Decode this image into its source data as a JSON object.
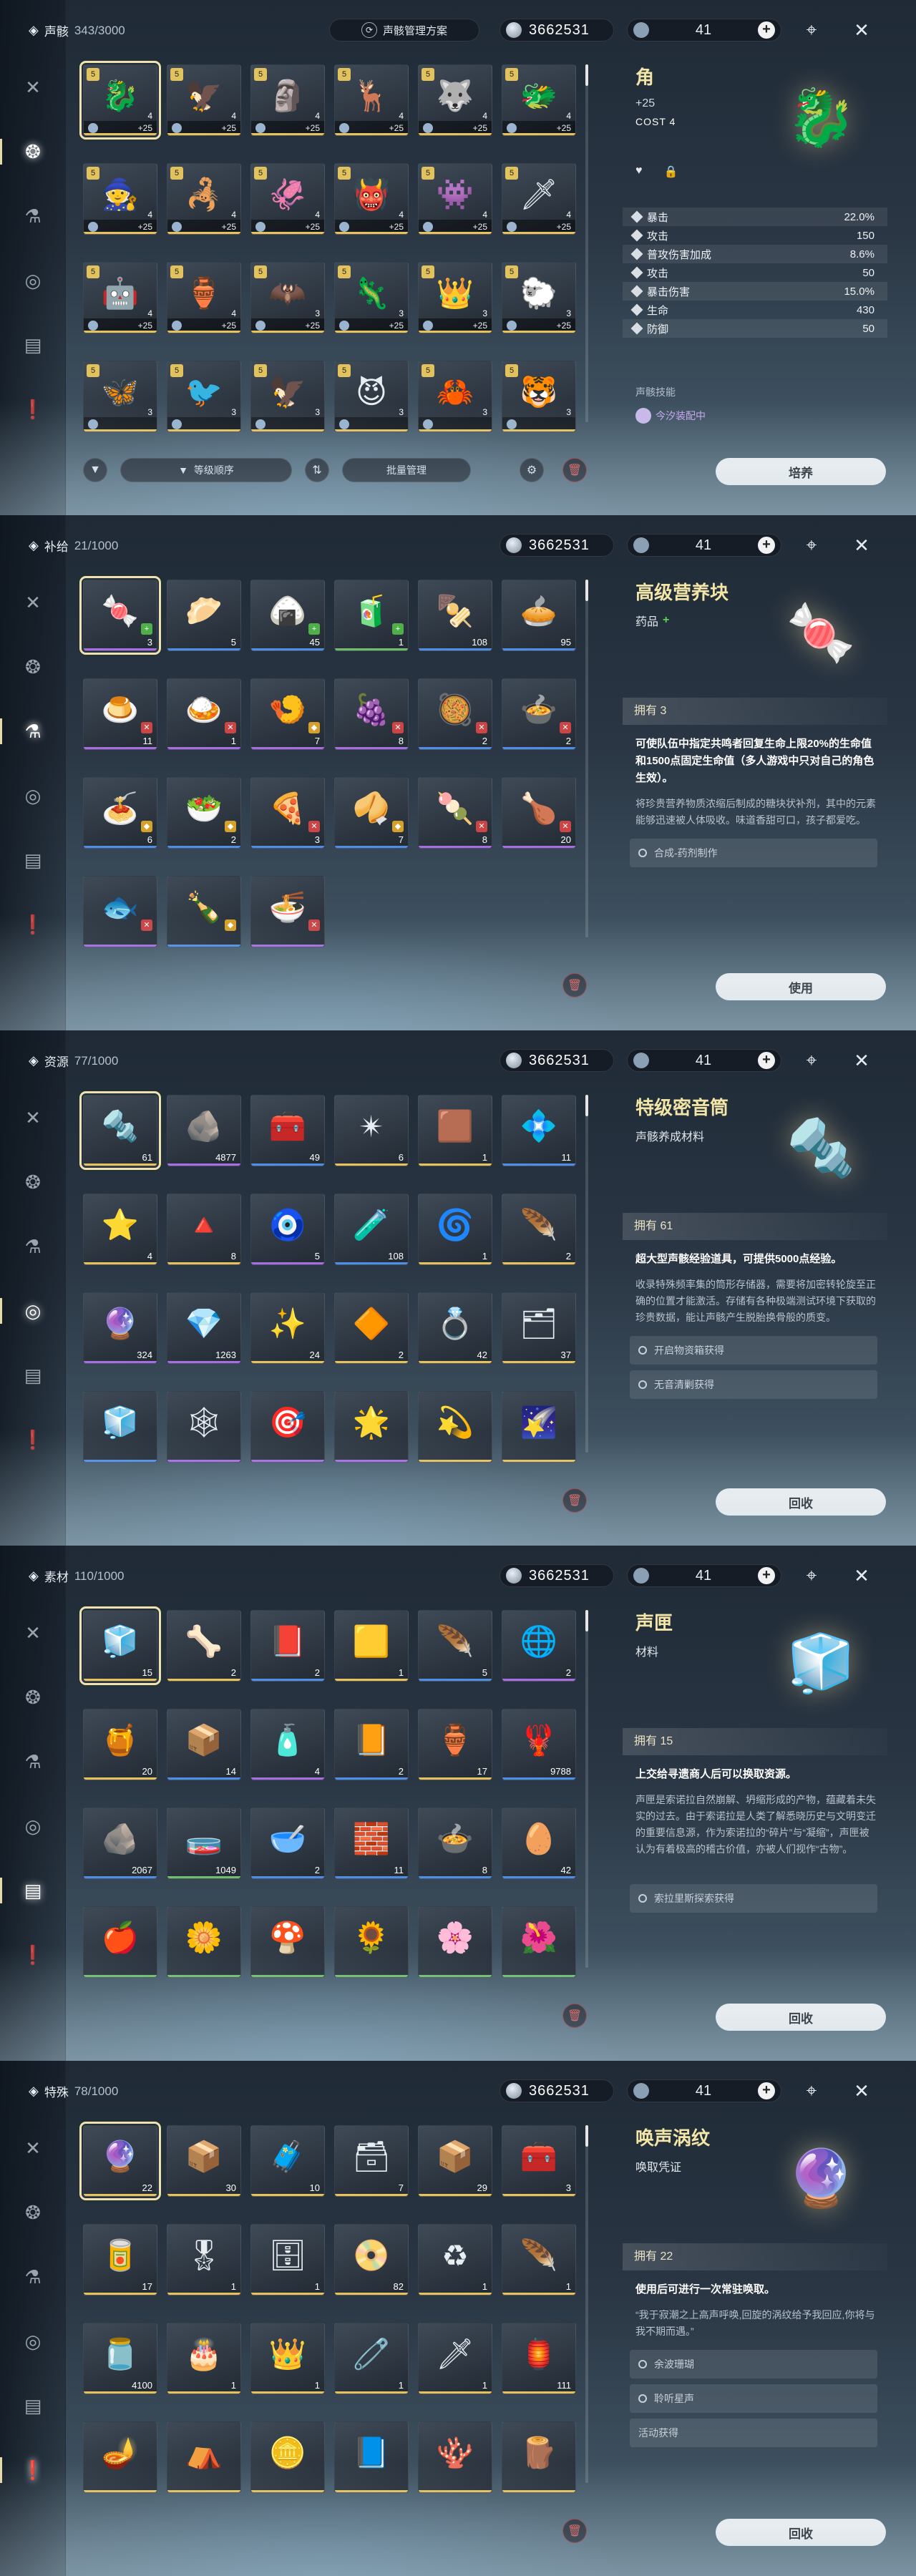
{
  "colors": {
    "accent_gold": "#f3e5a8",
    "rarity_gold": "#e7c25a",
    "rarity_purple": "#a76ce6",
    "rarity_blue": "#4f8ee8",
    "rarity_green": "#6fc06a"
  },
  "header": {
    "currency": "3662531",
    "stamina": "41",
    "plan_label": "声骸管理方案"
  },
  "nav_icons": [
    "crossed-swords-icon",
    "echo-mask-icon",
    "supplies-capsule-icon",
    "resources-icon",
    "materials-icon",
    "special-items-icon"
  ],
  "panels": [
    {
      "category": "声骸",
      "count": "343/3000",
      "active_nav": 1,
      "action": "培养",
      "sort_label": "等级顺序",
      "batch_label": "批量管理",
      "items": [
        {
          "icon": "🐉",
          "lvl": "5",
          "cost": "4",
          "plus": "+25",
          "rar": "gold",
          "sel": true
        },
        {
          "icon": "🦅",
          "lvl": "5",
          "cost": "4",
          "plus": "+25",
          "rar": "gold"
        },
        {
          "icon": "🗿",
          "lvl": "5",
          "cost": "4",
          "plus": "+25",
          "rar": "gold"
        },
        {
          "icon": "🦌",
          "lvl": "5",
          "cost": "4",
          "plus": "+25",
          "rar": "gold"
        },
        {
          "icon": "🐺",
          "lvl": "5",
          "cost": "4",
          "plus": "+25",
          "rar": "gold"
        },
        {
          "icon": "🐲",
          "lvl": "5",
          "cost": "4",
          "plus": "+25",
          "rar": "gold"
        },
        {
          "icon": "🧙",
          "lvl": "5",
          "cost": "4",
          "plus": "+25",
          "rar": "gold"
        },
        {
          "icon": "🦂",
          "lvl": "5",
          "cost": "4",
          "plus": "+25",
          "rar": "gold"
        },
        {
          "icon": "🦑",
          "lvl": "5",
          "cost": "4",
          "plus": "+25",
          "rar": "gold"
        },
        {
          "icon": "👹",
          "lvl": "5",
          "cost": "4",
          "plus": "+25",
          "rar": "gold"
        },
        {
          "icon": "👾",
          "lvl": "5",
          "cost": "4",
          "plus": "+25",
          "rar": "gold"
        },
        {
          "icon": "🗡",
          "lvl": "5",
          "cost": "4",
          "plus": "+25",
          "rar": "gold"
        },
        {
          "icon": "🤖",
          "lvl": "5",
          "cost": "4",
          "plus": "+25",
          "rar": "gold"
        },
        {
          "icon": "🏺",
          "lvl": "5",
          "cost": "4",
          "plus": "+25",
          "rar": "gold"
        },
        {
          "icon": "🦇",
          "lvl": "5",
          "cost": "3",
          "plus": "+25",
          "rar": "gold"
        },
        {
          "icon": "🦎",
          "lvl": "5",
          "cost": "3",
          "plus": "+25",
          "rar": "gold"
        },
        {
          "icon": "👑",
          "lvl": "5",
          "cost": "3",
          "plus": "+25",
          "rar": "gold"
        },
        {
          "icon": "🐑",
          "lvl": "5",
          "cost": "3",
          "plus": "+25",
          "rar": "gold"
        },
        {
          "icon": "🦋",
          "lvl": "5",
          "cost": "3",
          "plus": "",
          "rar": "gold"
        },
        {
          "icon": "🐦",
          "lvl": "5",
          "cost": "3",
          "plus": "",
          "rar": "gold"
        },
        {
          "icon": "🦅",
          "lvl": "5",
          "cost": "3",
          "plus": "",
          "rar": "gold"
        },
        {
          "icon": "😈",
          "lvl": "5",
          "cost": "3",
          "plus": "",
          "rar": "gold"
        },
        {
          "icon": "🦀",
          "lvl": "5",
          "cost": "3",
          "plus": "",
          "rar": "gold"
        },
        {
          "icon": "🐯",
          "lvl": "5",
          "cost": "3",
          "plus": "",
          "rar": "gold"
        }
      ],
      "detail": {
        "name": "角",
        "level": "+25",
        "cost": "COST 4",
        "icon": "🐉",
        "stats": [
          [
            "暴击",
            "22.0%"
          ],
          [
            "攻击",
            "150"
          ],
          [
            "普攻伤害加成",
            "8.6%"
          ],
          [
            "攻击",
            "50"
          ],
          [
            "暴击伤害",
            "15.0%"
          ],
          [
            "生命",
            "430"
          ],
          [
            "防御",
            "50"
          ]
        ],
        "skill": "声骸技能",
        "equipped": "今汐装配中"
      }
    },
    {
      "category": "补给",
      "count": "21/1000",
      "active_nav": 2,
      "action": "使用",
      "items": [
        {
          "icon": "🍬",
          "qty": "3",
          "rar": "purple",
          "mark": "g",
          "sel": true
        },
        {
          "icon": "🥟",
          "qty": "5",
          "rar": "blue"
        },
        {
          "icon": "🍙",
          "qty": "45",
          "rar": "blue",
          "mark": "g"
        },
        {
          "icon": "🧃",
          "qty": "1",
          "rar": "green",
          "mark": "g"
        },
        {
          "icon": "🍢",
          "qty": "108",
          "rar": "blue"
        },
        {
          "icon": "🥧",
          "qty": "95",
          "rar": "blue"
        },
        {
          "icon": "🍮",
          "qty": "11",
          "rar": "purple",
          "mark": "r"
        },
        {
          "icon": "🍛",
          "qty": "1",
          "rar": "purple",
          "mark": "r"
        },
        {
          "icon": "🍤",
          "qty": "7",
          "rar": "purple",
          "mark": "y"
        },
        {
          "icon": "🍇",
          "qty": "8",
          "rar": "purple",
          "mark": "r"
        },
        {
          "icon": "🥘",
          "qty": "2",
          "rar": "blue",
          "mark": "r"
        },
        {
          "icon": "🍲",
          "qty": "2",
          "rar": "blue",
          "mark": "r"
        },
        {
          "icon": "🍝",
          "qty": "6",
          "rar": "blue",
          "mark": "y"
        },
        {
          "icon": "🥗",
          "qty": "2",
          "rar": "blue",
          "mark": "y"
        },
        {
          "icon": "🍕",
          "qty": "3",
          "rar": "blue",
          "mark": "r"
        },
        {
          "icon": "🥠",
          "qty": "7",
          "rar": "blue",
          "mark": "y"
        },
        {
          "icon": "🍡",
          "qty": "8",
          "rar": "purple",
          "mark": "r"
        },
        {
          "icon": "🍗",
          "qty": "20",
          "rar": "purple",
          "mark": "r"
        },
        {
          "icon": "🐟",
          "qty": "",
          "rar": "purple",
          "mark": "r"
        },
        {
          "icon": "🍾",
          "qty": "",
          "rar": "blue",
          "mark": "y"
        },
        {
          "icon": "🍜",
          "qty": "",
          "rar": "purple",
          "mark": "r"
        }
      ],
      "detail": {
        "name": "高级营养块",
        "type": "药品",
        "icon": "🍬",
        "own": "拥有 3",
        "effect": "可使队伍中指定共鸣者回复生命上限20%的生命值和1500点固定生命值（多人游戏中只对自己的角色生效）。",
        "desc": "将珍贵营养物质浓缩后制成的糖块状补剂，其中的元素能够迅速被人体吸收。味道香甜可口，孩子都爱吃。",
        "sources": [
          "合成-药剂制作"
        ]
      }
    },
    {
      "category": "资源",
      "count": "77/1000",
      "active_nav": 3,
      "action": "回收",
      "items": [
        {
          "icon": "🔩",
          "qty": "61",
          "rar": "gold",
          "sel": true
        },
        {
          "icon": "🪨",
          "qty": "4877",
          "rar": "purple"
        },
        {
          "icon": "🧰",
          "qty": "49",
          "rar": "blue"
        },
        {
          "icon": "✴",
          "qty": "6",
          "rar": "gold"
        },
        {
          "icon": "🟫",
          "qty": "1",
          "rar": "gold"
        },
        {
          "icon": "💠",
          "qty": "11",
          "rar": "blue"
        },
        {
          "icon": "⭐",
          "qty": "4",
          "rar": "gold"
        },
        {
          "icon": "🔺",
          "qty": "8",
          "rar": "gold"
        },
        {
          "icon": "🧿",
          "qty": "5",
          "rar": "purple"
        },
        {
          "icon": "🧪",
          "qty": "108",
          "rar": "blue"
        },
        {
          "icon": "🌀",
          "qty": "1",
          "rar": "gold"
        },
        {
          "icon": "🪶",
          "qty": "2",
          "rar": "gold"
        },
        {
          "icon": "🔮",
          "qty": "324",
          "rar": "purple"
        },
        {
          "icon": "💎",
          "qty": "1263",
          "rar": "purple"
        },
        {
          "icon": "✨",
          "qty": "24",
          "rar": "gold"
        },
        {
          "icon": "🔶",
          "qty": "2",
          "rar": "gold"
        },
        {
          "icon": "💍",
          "qty": "42",
          "rar": "gold"
        },
        {
          "icon": "🗂",
          "qty": "37",
          "rar": "gold"
        },
        {
          "icon": "🧊",
          "qty": "",
          "rar": "blue"
        },
        {
          "icon": "🕸",
          "qty": "",
          "rar": "purple"
        },
        {
          "icon": "🎯",
          "qty": "",
          "rar": "purple"
        },
        {
          "icon": "🌟",
          "qty": "",
          "rar": "purple"
        },
        {
          "icon": "💫",
          "qty": "",
          "rar": "gold"
        },
        {
          "icon": "🌠",
          "qty": "",
          "rar": "gold"
        }
      ],
      "detail": {
        "name": "特级密音筒",
        "type": "声骸养成材料",
        "icon": "🔩",
        "own": "拥有 61",
        "effect": "超大型声骸经验道具，可提供5000点经验。",
        "desc": "收录特殊频率集的筒形存储器，需要将加密转轮旋至正确的位置才能激活。存储有各种极端测试环境下获取的珍贵数据，能让声骸产生脱胎换骨般的质变。",
        "sources": [
          "开启物资箱获得",
          "无音清剿获得"
        ]
      }
    },
    {
      "category": "素材",
      "count": "110/1000",
      "active_nav": 4,
      "action": "回收",
      "items": [
        {
          "icon": "🧊",
          "qty": "15",
          "rar": "gold",
          "sel": true
        },
        {
          "icon": "🦴",
          "qty": "2",
          "rar": "gold"
        },
        {
          "icon": "📕",
          "qty": "2",
          "rar": "blue"
        },
        {
          "icon": "🟨",
          "qty": "1",
          "rar": "gold"
        },
        {
          "icon": "🪶",
          "qty": "5",
          "rar": "blue"
        },
        {
          "icon": "🌐",
          "qty": "2",
          "rar": "purple"
        },
        {
          "icon": "🍯",
          "qty": "20",
          "rar": "gold"
        },
        {
          "icon": "📦",
          "qty": "14",
          "rar": "blue"
        },
        {
          "icon": "🧴",
          "qty": "4",
          "rar": "purple"
        },
        {
          "icon": "📙",
          "qty": "2",
          "rar": "blue"
        },
        {
          "icon": "🏺",
          "qty": "17",
          "rar": "gold"
        },
        {
          "icon": "🦞",
          "qty": "9788",
          "rar": "blue"
        },
        {
          "icon": "🪨",
          "qty": "2067",
          "rar": "blue"
        },
        {
          "icon": "🧫",
          "qty": "1049",
          "rar": "green"
        },
        {
          "icon": "🥣",
          "qty": "2",
          "rar": "blue"
        },
        {
          "icon": "🧱",
          "qty": "11",
          "rar": "blue"
        },
        {
          "icon": "🍲",
          "qty": "8",
          "rar": "blue"
        },
        {
          "icon": "🥚",
          "qty": "42",
          "rar": "blue"
        },
        {
          "icon": "🍎",
          "qty": "",
          "rar": "green"
        },
        {
          "icon": "🌼",
          "qty": "",
          "rar": "green"
        },
        {
          "icon": "🍄",
          "qty": "",
          "rar": "green"
        },
        {
          "icon": "🌻",
          "qty": "",
          "rar": "green"
        },
        {
          "icon": "🌸",
          "qty": "",
          "rar": "green"
        },
        {
          "icon": "🌺",
          "qty": "",
          "rar": "green"
        }
      ],
      "detail": {
        "name": "声匣",
        "type": "材料",
        "icon": "🧊",
        "own": "拥有 15",
        "effect": "上交给寻遗商人后可以换取资源。",
        "desc": "声匣是索诺拉自然崩解、坍缩形成的产物，蕴藏着未失实的过去。由于索诺拉是人类了解悉晓历史与文明变迁的重要信息源，作为索诺拉的“碎片”与“凝缩”，声匣被认为有着极高的稽古价值，亦被人们视作“古物”。",
        "sources": [
          "索拉里斯探索获得"
        ]
      }
    },
    {
      "category": "特殊",
      "count": "78/1000",
      "active_nav": 5,
      "action": "回收",
      "items": [
        {
          "icon": "🔮",
          "qty": "22",
          "rar": "gold",
          "sel": true
        },
        {
          "icon": "📦",
          "qty": "30",
          "rar": "gold"
        },
        {
          "icon": "🧳",
          "qty": "10",
          "rar": "gold"
        },
        {
          "icon": "🗃",
          "qty": "7",
          "rar": "gold"
        },
        {
          "icon": "📦",
          "qty": "29",
          "rar": "gold"
        },
        {
          "icon": "🧰",
          "qty": "3",
          "rar": "gold"
        },
        {
          "icon": "🥫",
          "qty": "17",
          "rar": "gold"
        },
        {
          "icon": "🎖",
          "qty": "1",
          "rar": "gold"
        },
        {
          "icon": "🗄",
          "qty": "1",
          "rar": "gold"
        },
        {
          "icon": "📀",
          "qty": "82",
          "rar": "gold"
        },
        {
          "icon": "♻",
          "qty": "1",
          "rar": "gold"
        },
        {
          "icon": "🪶",
          "qty": "1",
          "rar": "gold"
        },
        {
          "icon": "🫙",
          "qty": "4100",
          "rar": "gold"
        },
        {
          "icon": "🎂",
          "qty": "1",
          "rar": "gold"
        },
        {
          "icon": "👑",
          "qty": "1",
          "rar": "gold"
        },
        {
          "icon": "🧷",
          "qty": "1",
          "rar": "gold"
        },
        {
          "icon": "🗡",
          "qty": "1",
          "rar": "gold"
        },
        {
          "icon": "🏮",
          "qty": "111",
          "rar": "gold"
        },
        {
          "icon": "🪔",
          "qty": "",
          "rar": "gold"
        },
        {
          "icon": "⛺",
          "qty": "",
          "rar": "gold"
        },
        {
          "icon": "🪙",
          "qty": "",
          "rar": "gold"
        },
        {
          "icon": "📘",
          "qty": "",
          "rar": "gold"
        },
        {
          "icon": "🪸",
          "qty": "",
          "rar": "gold"
        },
        {
          "icon": "🪵",
          "qty": "",
          "rar": "gold"
        }
      ],
      "detail": {
        "name": "唤声涡纹",
        "type": "唤取凭证",
        "icon": "🔮",
        "own": "拥有 22",
        "effect": "使用后可进行一次常驻唤取。",
        "desc": "“我于寂潮之上高声呼唤,回旋的涡纹给予我回应,你将与我不期而遇。”",
        "sources": [
          "余波珊瑚",
          "聆听星声",
          "活动获得"
        ]
      }
    }
  ]
}
